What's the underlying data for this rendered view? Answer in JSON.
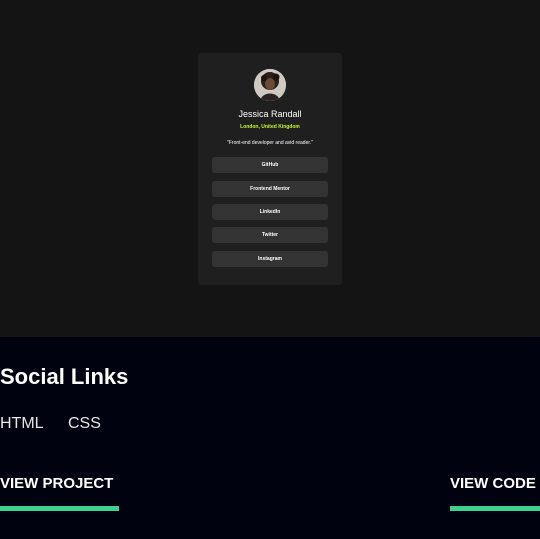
{
  "preview": {
    "card": {
      "avatar": "profile-photo",
      "name": "Jessica Randall",
      "location": "London, United Kingdom",
      "bio": "\"Front-end developer and avid reader.\"",
      "links": [
        "GitHub",
        "Frontend Mentor",
        "LinkedIn",
        "Twitter",
        "Instagram"
      ]
    }
  },
  "project": {
    "title": "Social Links",
    "tags": [
      "HTML",
      "CSS"
    ],
    "view_project": "VIEW PROJECT",
    "view_code": "VIEW CODE",
    "accent_color": "#3fcf8e"
  },
  "colors": {
    "preview_bg": "#141414",
    "card_bg": "#1f1f1f",
    "button_bg": "#333333",
    "location": "#c4f82a",
    "page_bg": "#00030f"
  }
}
